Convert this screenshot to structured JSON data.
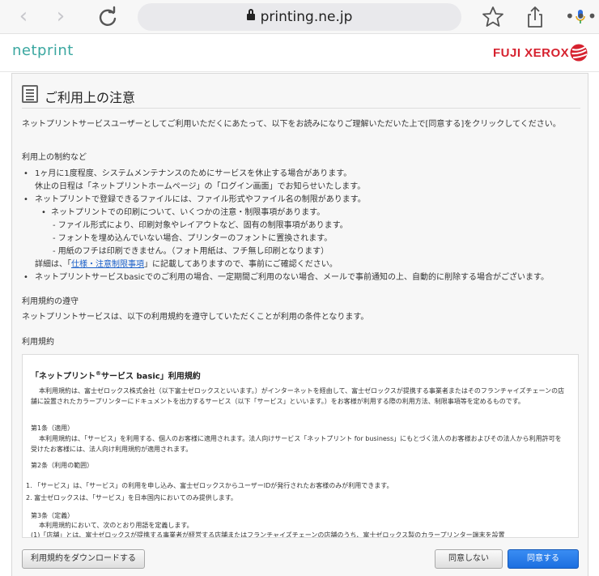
{
  "browser": {
    "url": "printing.ne.jp"
  },
  "header": {
    "logo_left": "netprint",
    "logo_right": "FUJI XEROX"
  },
  "notice": {
    "title": "ご利用上の注意",
    "intro": "ネットプリントサービスユーザーとしてご利用いただくにあたって、以下をお読みになりご理解いただいた上で[同意する]をクリックしてください。",
    "section1_heading": "利用上の制約など",
    "b1": "1ヶ月に1度程度、システムメンテナンスのためにサービスを休止する場合があります。",
    "b1_sub": "休止の日程は「ネットプリントホームページ」の「ログイン画面」でお知らせいたします。",
    "b2": "ネットプリントで登録できるファイルには、ファイル形式やファイル名の制限があります。",
    "b2_1": "ネットプリントでの印刷について、いくつかの注意・制限事項があります。",
    "b2_1a": "- ファイル形式により、印刷対象やレイアウトなど、固有の制限事項があります。",
    "b2_1b": "- フォントを埋め込んでいない場合、プリンターのフォントに置換されます。",
    "b2_1c": "- 用紙のフチは印刷できません。（フォト用紙は、フチ無し印刷となります）",
    "b2_detail_pre": "詳細は、「",
    "b2_detail_link": "仕様・注意制限事項",
    "b2_detail_post": "」に記載してありますので、事前にご確認ください。",
    "b3": "ネットプリントサービスbasicでのご利用の場合、一定期間ご利用のない場合、メールで事前通知の上、自動的に削除する場合がございます。",
    "section2_heading": "利用規約の遵守",
    "section2_text": "ネットプリントサービスは、以下の利用規約を遵守していただくことが利用の条件となります。",
    "section3_heading": "利用規約"
  },
  "terms": {
    "title_pre": "「ネットプリント",
    "title_sup": "®",
    "title_post": "サービス basic」利用規約",
    "para1": "本利用規約は、富士ゼロックス株式会社（以下富士ゼロックスといいます。）がインターネットを経由して、富士ゼロックスが提携する事業者またはそのフランチャイズチェーンの店舗に設置されたカラープリンターにドキュメントを出力するサービス（以下「サービス」といいます。）をお客様が利用する際の利用方法、制限事項等を定めるものです。",
    "art1_title": "第1条（適用）",
    "art1_text": "本利用規約は、「サービス」を利用する、個人のお客様に適用されます。法人向けサービス「ネットプリント for business」にもとづく法人のお客様およびその法人から利用許可を受けたお客様には、法人向け利用規約が適用されます。",
    "art2_title": "第2条（利用の範囲）",
    "art2_1": "1. 「サービス」は、「サービス」の利用を申し込み、富士ゼロックスからユーザーIDが発行されたお客様のみが利用できます。",
    "art2_2": "2. 富士ゼロックスは、「サービス」を日本国内においてのみ提供します。",
    "art3_title": "第3条（定義）",
    "art3_text": "本利用規約において、次のとおり用語を定義します。",
    "art3_1": "(1)「店舗」とは、富士ゼロックスが提携する事業者が経営する店舗またはフランチャイズチェーンの店舗のうち、富士ゼロックス製のカラープリンター端末を設置"
  },
  "buttons": {
    "download": "利用規約をダウンロードする",
    "disagree": "同意しない",
    "agree": "同意する"
  }
}
